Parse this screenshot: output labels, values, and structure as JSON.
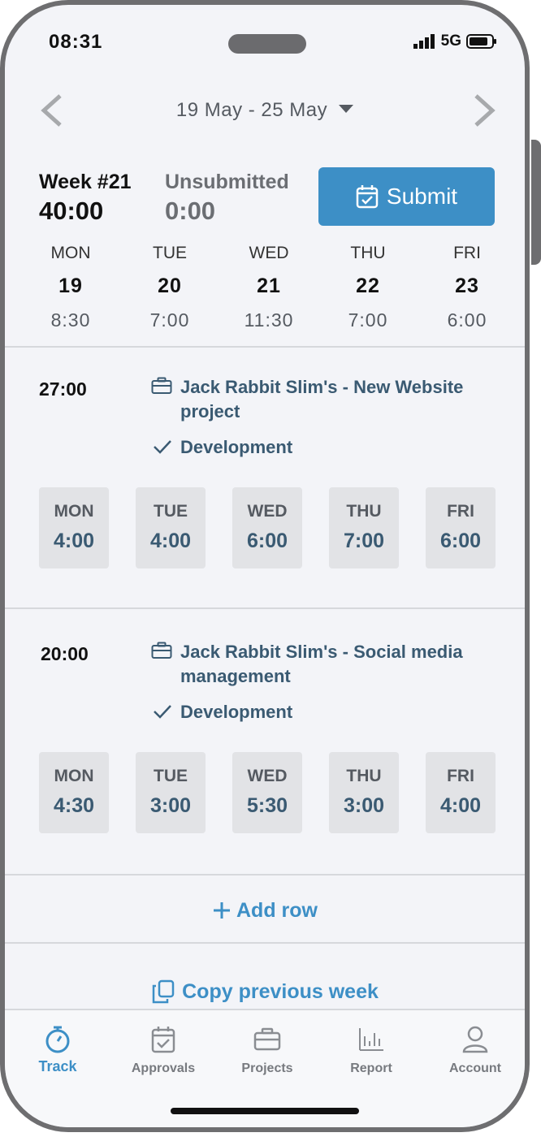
{
  "status_bar": {
    "time": "08:31",
    "network": "5G"
  },
  "week_nav": {
    "range": "19 May - 25 May"
  },
  "summary": {
    "week_label": "Week #21",
    "week_total": "40:00",
    "unsubmitted_label": "Unsubmitted",
    "unsubmitted_total": "0:00",
    "submit_label": "Submit"
  },
  "days": [
    {
      "name": "MON",
      "num": "19",
      "hours": "8:30"
    },
    {
      "name": "TUE",
      "num": "20",
      "hours": "7:00"
    },
    {
      "name": "WED",
      "num": "21",
      "hours": "11:30"
    },
    {
      "name": "THU",
      "num": "22",
      "hours": "7:00"
    },
    {
      "name": "FRI",
      "num": "23",
      "hours": "6:00"
    }
  ],
  "entries": [
    {
      "total": "27:00",
      "project": "Jack Rabbit Slim's - New Website project",
      "task": "Development",
      "cells": [
        {
          "day": "MON",
          "hours": "4:00"
        },
        {
          "day": "TUE",
          "hours": "4:00"
        },
        {
          "day": "WED",
          "hours": "6:00"
        },
        {
          "day": "THU",
          "hours": "7:00"
        },
        {
          "day": "FRI",
          "hours": "6:00"
        }
      ]
    },
    {
      "total": "20:00",
      "project": "Jack Rabbit Slim's - Social media management",
      "task": "Development",
      "cells": [
        {
          "day": "MON",
          "hours": "4:30"
        },
        {
          "day": "TUE",
          "hours": "3:00"
        },
        {
          "day": "WED",
          "hours": "5:30"
        },
        {
          "day": "THU",
          "hours": "3:00"
        },
        {
          "day": "FRI",
          "hours": "4:00"
        }
      ]
    }
  ],
  "actions": {
    "add_row": "Add row",
    "copy_previous": "Copy previous week"
  },
  "tabs": [
    {
      "label": "Track",
      "icon": "stopwatch-icon",
      "active": true
    },
    {
      "label": "Approvals",
      "icon": "calendar-check-icon",
      "active": false
    },
    {
      "label": "Projects",
      "icon": "briefcase-icon",
      "active": false
    },
    {
      "label": "Report",
      "icon": "bar-chart-icon",
      "active": false
    },
    {
      "label": "Account",
      "icon": "user-icon",
      "active": false
    }
  ],
  "colors": {
    "accent": "#3d8fc6",
    "project_text": "#3a5a72",
    "background": "#f3f4f8"
  }
}
